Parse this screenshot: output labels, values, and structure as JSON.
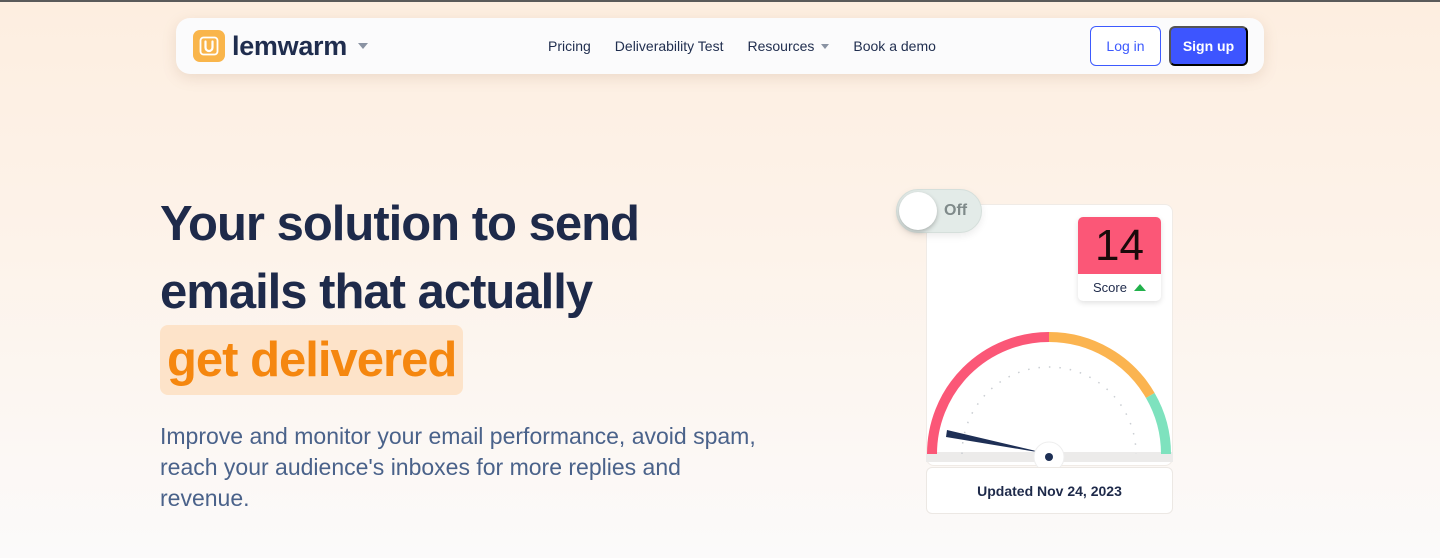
{
  "brand": {
    "name": "lemwarm",
    "logo_color": "#f9b54b"
  },
  "nav": {
    "links": [
      {
        "label": "Pricing",
        "has_caret": false
      },
      {
        "label": "Deliverability Test",
        "has_caret": false
      },
      {
        "label": "Resources",
        "has_caret": true
      },
      {
        "label": "Book a demo",
        "has_caret": false
      }
    ],
    "login_label": "Log in",
    "signup_label": "Sign up",
    "accent_color": "#3d55ff"
  },
  "hero": {
    "headline_line1": "Your solution to send",
    "headline_line2": "emails that actually",
    "highlight": "get delivered",
    "subtitle": "Improve and monitor your email performance, avoid spam, reach your audience's inboxes for more replies and revenue."
  },
  "widget": {
    "toggle_label": "Off",
    "score": "14",
    "score_label": "Score",
    "score_trend": "up",
    "updated": "Updated Nov 24, 2023",
    "gauge_colors": {
      "low": "#fb5777",
      "mid": "#fbb450",
      "high": "#7ee2be"
    }
  }
}
